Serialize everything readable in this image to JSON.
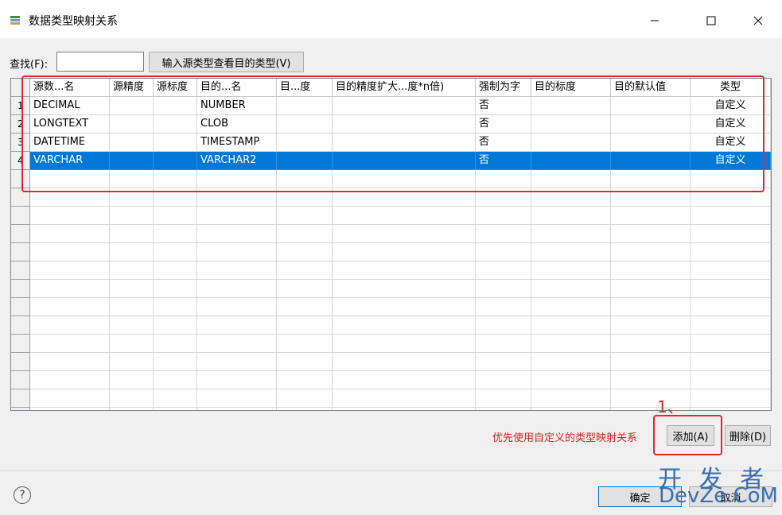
{
  "window": {
    "title": "数据类型映射关系",
    "minimize": "—",
    "maximize": "☐",
    "close": "✕"
  },
  "toolbar": {
    "find_label": "查找(F):",
    "find_value": "",
    "lookup_button": "输入源类型查看目的类型(V)"
  },
  "table": {
    "columns": [
      "源数...名",
      "源精度",
      "源标度",
      "目的...名",
      "目...度",
      "目的精度扩大...度*n倍)",
      "强制为字",
      "目的标度",
      "目的默认值",
      "类型"
    ],
    "rows": [
      {
        "num": "1",
        "cells": [
          "DECIMAL",
          "",
          "",
          "NUMBER",
          "",
          "",
          "否",
          "",
          "",
          "自定义"
        ]
      },
      {
        "num": "2",
        "cells": [
          "LONGTEXT",
          "",
          "",
          "CLOB",
          "",
          "",
          "否",
          "",
          "",
          "自定义"
        ]
      },
      {
        "num": "3",
        "cells": [
          "DATETIME",
          "",
          "",
          "TIMESTAMP",
          "",
          "",
          "否",
          "",
          "",
          "自定义"
        ]
      },
      {
        "num": "4",
        "cells": [
          "VARCHAR",
          "",
          "",
          "VARCHAR2",
          "",
          "",
          "否",
          "",
          "",
          "自定义"
        ],
        "selected": true
      }
    ],
    "empty_rows": 14
  },
  "hint": "优先使用自定义的类型映射关系",
  "annotation_number": "1、",
  "buttons": {
    "add": "添加(A)",
    "delete": "删除(D)",
    "ok": "确定",
    "cancel": "取消"
  },
  "help": "?",
  "watermark": {
    "line1": "开 发 者",
    "line2": "DevZe.CoM"
  },
  "colors": {
    "selection": "#0078d7",
    "annotation": "#e8262a",
    "hint": "#e02020"
  }
}
